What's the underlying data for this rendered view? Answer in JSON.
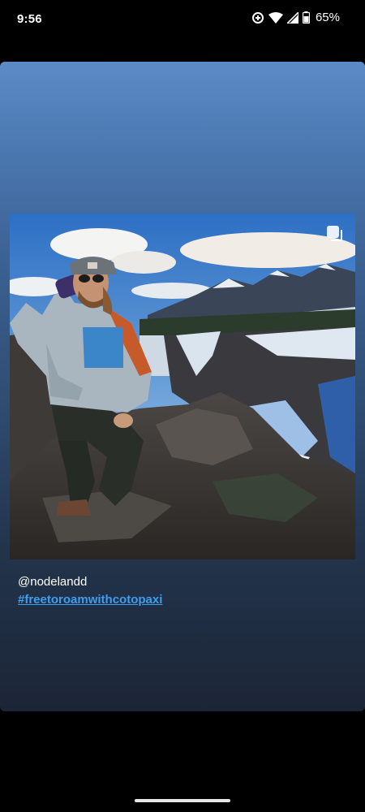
{
  "status_bar": {
    "time": "9:56",
    "battery_percent": "65%",
    "icons": [
      "data-saver-icon",
      "wifi-icon",
      "cell-signal-icon",
      "battery-icon"
    ]
  },
  "post": {
    "media_type_icon": "multiple-images-icon",
    "username": "@nodelandd",
    "hashtag": "#freetoroamwithcotopaxi"
  },
  "colors": {
    "hashtag": "#3e9ef0",
    "card_top": "#5b8bc6",
    "card_bottom": "#1c2536"
  }
}
